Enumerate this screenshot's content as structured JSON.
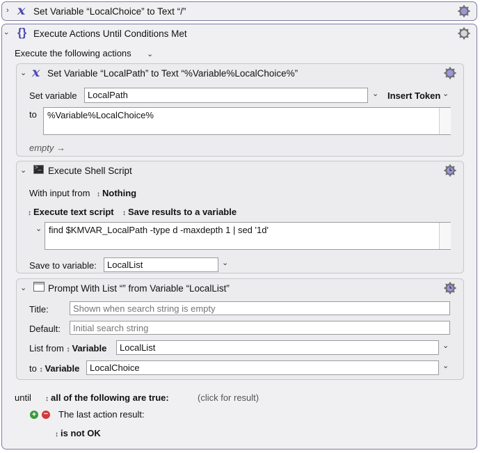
{
  "top_action": {
    "title": "Set Variable “LocalChoice” to Text “/”"
  },
  "until_block": {
    "title": "Execute Actions Until Conditions Met",
    "execute_label": "Execute the following actions",
    "until_label": "until",
    "condition_mode": "all of the following are true:",
    "click_result": "(click for result)",
    "condition_label": "The last action result:",
    "condition_value": "is not OK"
  },
  "set_variable": {
    "title": "Set Variable “LocalPath” to Text “%Variable%LocalChoice%”",
    "set_label": "Set variable",
    "var_name": "LocalPath",
    "insert_token": "Insert Token",
    "to_label": "to",
    "to_value": "%Variable%LocalChoice%",
    "preview": "empty"
  },
  "shell_script": {
    "title": "Execute Shell Script",
    "input_label": "With input from",
    "input_value": "Nothing",
    "mode": "Execute text script",
    "save_mode": "Save results to a variable",
    "script": "find $KMVAR_LocalPath -type d -maxdepth 1 | sed '1d'",
    "save_label": "Save to variable:",
    "save_var": "LocalList"
  },
  "prompt_list": {
    "title": "Prompt With List “” from Variable “LocalList”",
    "title_label": "Title:",
    "title_placeholder": "Shown when search string is empty",
    "default_label": "Default:",
    "default_placeholder": "Initial search string",
    "list_from_label": "List from",
    "list_from_type": "Variable",
    "list_from_value": "LocalList",
    "to_label": "to",
    "to_type": "Variable",
    "to_value": "LocalChoice"
  },
  "colors": {
    "accent": "#4e4ab0",
    "border": "#7d7aa6"
  },
  "icons": [
    "x-variable-icon",
    "braces-icon",
    "terminal-icon",
    "window-list-icon",
    "gear-icon",
    "clock-gear-icon",
    "add-condition-icon",
    "remove-condition-icon"
  ]
}
